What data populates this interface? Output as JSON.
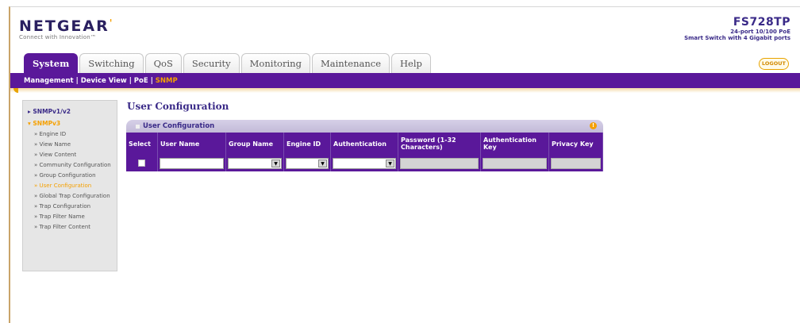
{
  "brand": {
    "logo": "NETGEAR",
    "tagline": "Connect with Innovation™",
    "model": "FS728TP",
    "desc1": "24-port 10/100 PoE",
    "desc2": "Smart Switch with 4 Gigabit ports"
  },
  "tabs": [
    {
      "label": "System",
      "active": true
    },
    {
      "label": "Switching",
      "active": false
    },
    {
      "label": "QoS",
      "active": false
    },
    {
      "label": "Security",
      "active": false
    },
    {
      "label": "Monitoring",
      "active": false
    },
    {
      "label": "Maintenance",
      "active": false
    },
    {
      "label": "Help",
      "active": false
    }
  ],
  "logout_label": "LOGOUT",
  "subnav": [
    "Management",
    "Device View",
    "PoE",
    "SNMP"
  ],
  "sidebar": {
    "group1": "SNMPv1/v2",
    "group2": "SNMPv3",
    "items": [
      "Engine ID",
      "View Name",
      "View Content",
      "Community Configuration",
      "Group Configuration",
      "User Configuration",
      "Global Trap Configuration",
      "Trap Configuration",
      "Trap Filter Name",
      "Trap Filter Content"
    ],
    "current_index": 5
  },
  "main": {
    "title": "User Configuration",
    "panel_title": "User Configuration",
    "columns": [
      "Select",
      "User Name",
      "Group Name",
      "Engine ID",
      "Authentication",
      "Password (1-32 Characters)",
      "Authentication Key",
      "Privacy Key"
    ],
    "row": {
      "user_name": "",
      "group_name": "",
      "engine_id": "",
      "authentication": "",
      "password": "",
      "auth_key": "",
      "privacy_key": ""
    }
  },
  "colors": {
    "purple": "#5a189a",
    "orange": "#f5a000",
    "navy": "#3a2a88"
  }
}
